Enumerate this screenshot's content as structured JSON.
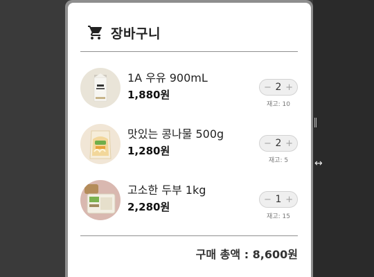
{
  "cart": {
    "title": "장바구니",
    "items": [
      {
        "name": "1A 우유 900mL",
        "price": "1,880원",
        "quantity": "2",
        "stock": "재고: 10",
        "thumb_icon": "milk-carton"
      },
      {
        "name": "맛있는 콩나물 500g",
        "price": "1,280원",
        "quantity": "2",
        "stock": "재고: 5",
        "thumb_icon": "bean-sprouts-bag"
      },
      {
        "name": "고소한 두부 1kg",
        "price": "2,280원",
        "quantity": "1",
        "stock": "재고: 15",
        "thumb_icon": "tofu-box"
      }
    ],
    "decrement_label": "−",
    "increment_label": "+",
    "total": "구매 총액 : 8,600원"
  },
  "colors": {
    "panel_bg": "#ffffff",
    "page_bg": "#3a3a3a",
    "divider": "#8f8f8f",
    "stepper_bg": "#efefef"
  }
}
